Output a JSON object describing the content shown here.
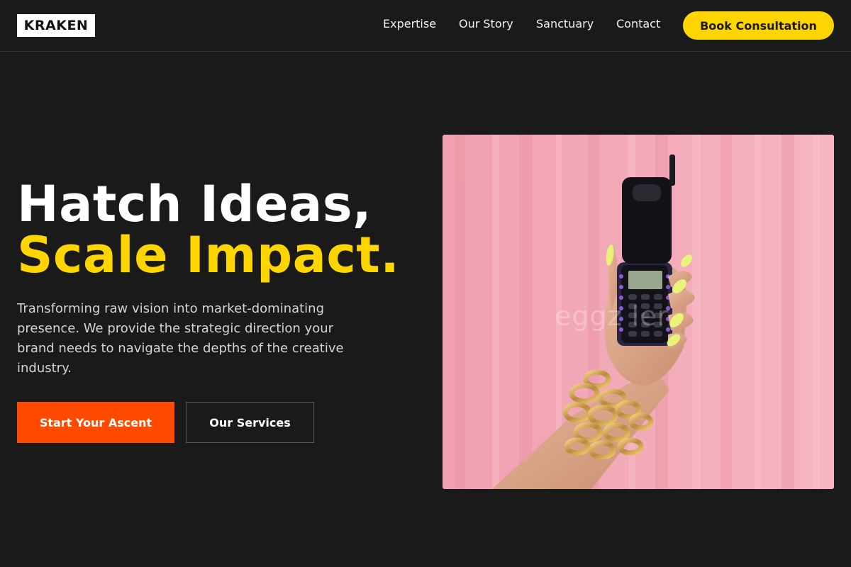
{
  "brand": {
    "logo": "KRAKEN"
  },
  "nav": {
    "links": [
      "Expertise",
      "Our Story",
      "Sanctuary",
      "Contact"
    ],
    "cta": "Book Consultation"
  },
  "hero": {
    "title_line1": "Hatch Ideas,",
    "title_line2": "Scale Impact.",
    "description": "Transforming raw vision into market-dominating presence. We provide the strategic direction your brand needs to navigate the depths of the creative industry.",
    "primary_button": "Start Your Ascent",
    "secondary_button": "Our Services",
    "image_watermark": "eggz    ler"
  },
  "colors": {
    "background": "#1a1a1a",
    "accent_yellow": "#ffd500",
    "accent_orange": "#ff4a00",
    "image_pink": "#f2a3b3"
  }
}
